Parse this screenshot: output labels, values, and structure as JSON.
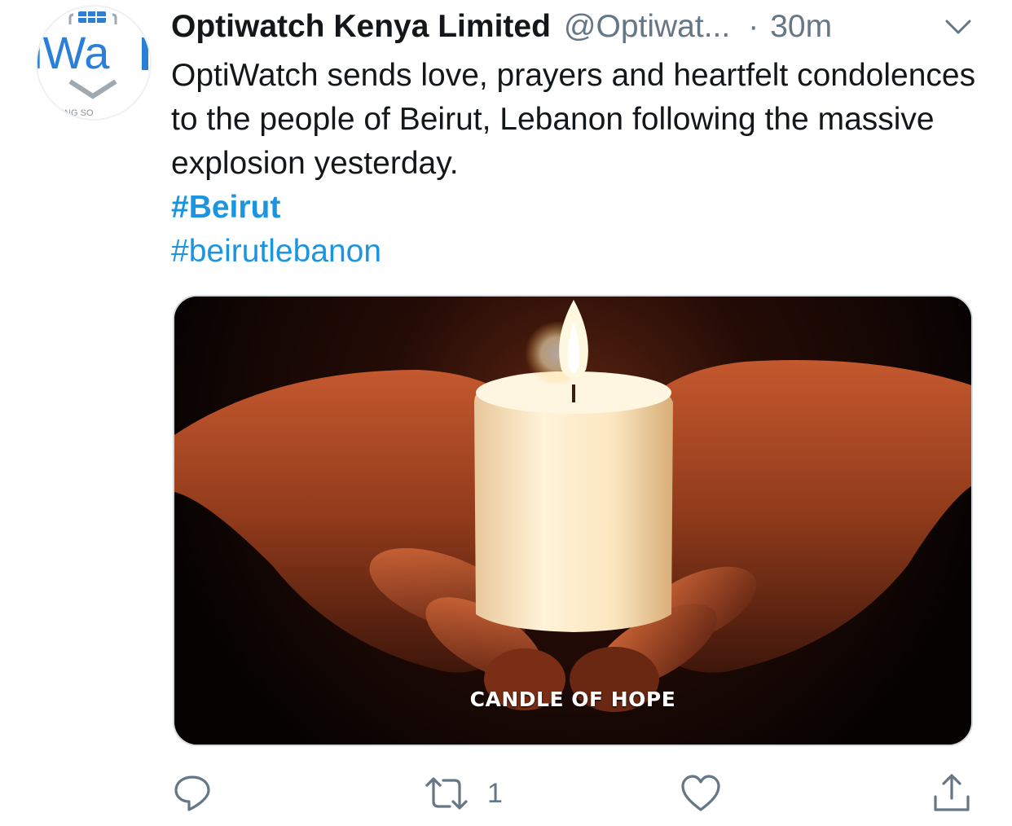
{
  "author": {
    "display_name": "Optiwatch Kenya Limited",
    "handle": "@Optiwat...",
    "separator": "·",
    "timestamp": "30m",
    "avatar_text": "iWa",
    "avatar_subtext": "ING SO"
  },
  "tweet": {
    "text": "OptiWatch sends love, prayers and heartfelt condolences to the people of Beirut, Lebanon following the massive explosion yesterday.",
    "hashtags": [
      "#Beirut",
      "#beirutlebanon"
    ]
  },
  "media": {
    "caption": "CANDLE OF HOPE",
    "description_icon": "candle-in-hands-image"
  },
  "actions": {
    "reply_count": "",
    "retweet_count": "1",
    "like_count": ""
  },
  "colors": {
    "link": "#1b95e0",
    "text": "#14171a",
    "muted": "#657786",
    "brand_blue": "#2b7fd8"
  }
}
